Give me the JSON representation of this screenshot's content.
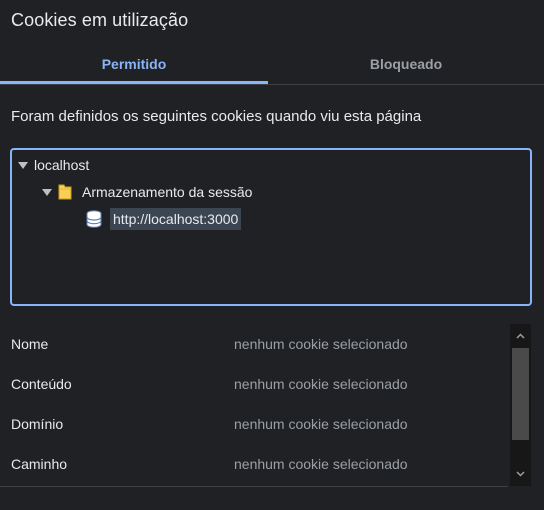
{
  "dialog": {
    "title": "Cookies em utilização"
  },
  "tabs": [
    {
      "label": "Permitido",
      "active": true
    },
    {
      "label": "Bloqueado",
      "active": false
    }
  ],
  "description": "Foram definidos os seguintes cookies quando viu esta página",
  "tree": {
    "root": {
      "label": "localhost",
      "expanded": true
    },
    "child": {
      "label": "Armazenamento da sessão",
      "expanded": true,
      "icon": "folder-icon"
    },
    "leaf": {
      "label": "http://localhost:3000",
      "selected": true,
      "icon": "database-icon"
    }
  },
  "details": [
    {
      "label": "Nome",
      "value": "nenhum cookie selecionado"
    },
    {
      "label": "Conteúdo",
      "value": "nenhum cookie selecionado"
    },
    {
      "label": "Domínio",
      "value": "nenhum cookie selecionado"
    },
    {
      "label": "Caminho",
      "value": "nenhum cookie selecionado"
    }
  ],
  "colors": {
    "background": "#202124",
    "accent": "#8ab4f8",
    "text": "#e8eaed",
    "muted": "#9aa0a6",
    "selection": "#3c4653"
  }
}
